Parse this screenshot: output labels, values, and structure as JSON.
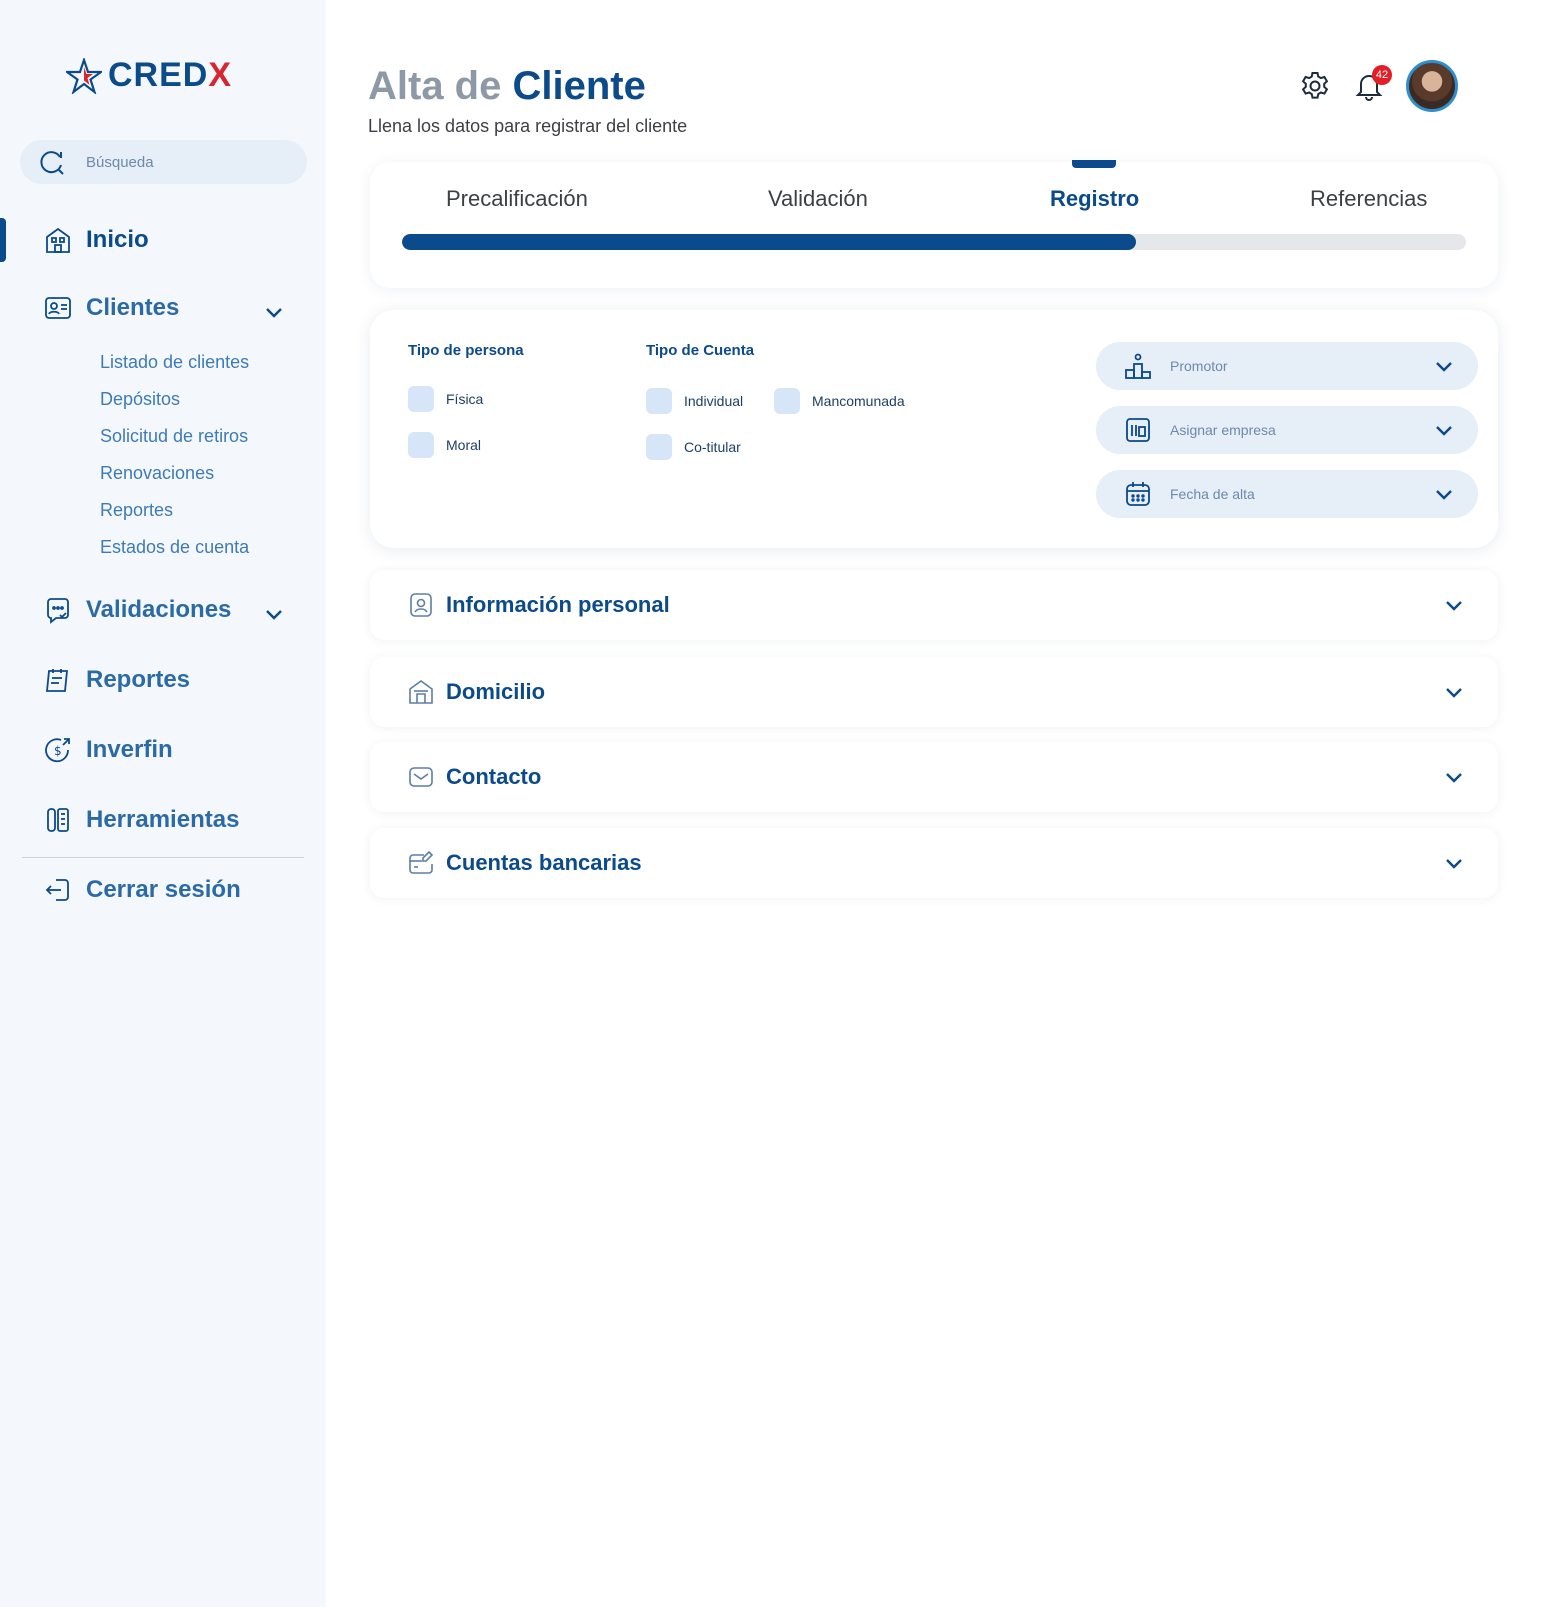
{
  "brand": {
    "name_main": "CRED",
    "name_x": "X"
  },
  "search": {
    "placeholder": "Búsqueda"
  },
  "nav": {
    "inicio": "Inicio",
    "clientes": "Clientes",
    "clientes_sub": [
      "Listado de clientes",
      "Depósitos",
      "Solicitud de retiros",
      "Renovaciones",
      "Reportes",
      "Estados de cuenta"
    ],
    "validaciones": "Validaciones",
    "reportes": "Reportes",
    "inverfin": "Inverfin",
    "herramientas": "Herramientas",
    "cerrar": "Cerrar sesión"
  },
  "header": {
    "title_pre": "Alta de",
    "title_main": "Cliente",
    "subtitle": "Llena los datos para registrar del cliente",
    "notifications": "42"
  },
  "stepper": {
    "steps": [
      "Precalificación",
      "Validación",
      "Registro",
      "Referencias"
    ],
    "active": "Registro",
    "progress": 0.69
  },
  "form": {
    "tipo_persona": {
      "label": "Tipo de persona",
      "options": [
        "Física",
        "Moral"
      ]
    },
    "tipo_cuenta": {
      "label": "Tipo de Cuenta",
      "options": [
        "Individual",
        "Mancomunada",
        "Co-titular"
      ]
    },
    "dropdowns": [
      "Promotor",
      "Asignar empresa",
      "Fecha de alta"
    ]
  },
  "sections": [
    "Información personal",
    "Domicilio",
    "Contacto",
    "Cuentas bancarias"
  ],
  "colors": {
    "primary": "#0b4a8b",
    "accent_red": "#d8262f",
    "sidebar_bg": "#f4f8fc",
    "badge": "#e41e26"
  }
}
